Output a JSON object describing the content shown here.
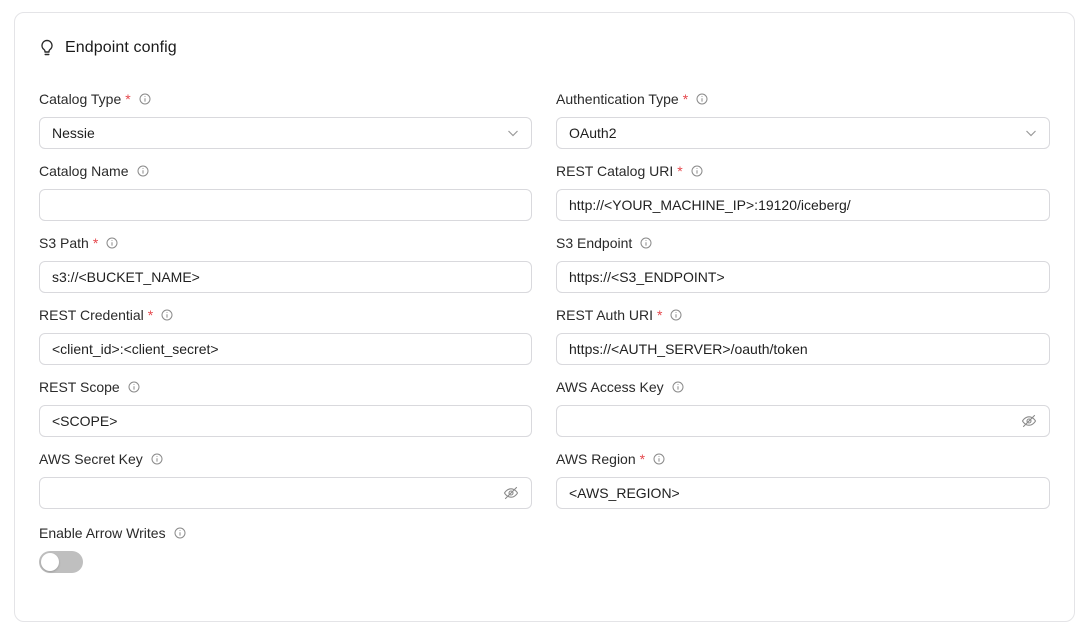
{
  "header": {
    "title": "Endpoint config",
    "icon": "lightbulb-icon"
  },
  "fields": {
    "catalog_type": {
      "label": "Catalog Type",
      "required": "*",
      "value": "Nessie"
    },
    "auth_type": {
      "label": "Authentication Type",
      "required": "*",
      "value": "OAuth2"
    },
    "catalog_name": {
      "label": "Catalog Name",
      "value": ""
    },
    "rest_catalog_uri": {
      "label": "REST Catalog URI",
      "required": "*",
      "value": "http://<YOUR_MACHINE_IP>:19120/iceberg/"
    },
    "s3_path": {
      "label": "S3 Path",
      "required": "*",
      "value": "s3://<BUCKET_NAME>"
    },
    "s3_endpoint": {
      "label": "S3 Endpoint",
      "value": "https://<S3_ENDPOINT>"
    },
    "rest_credential": {
      "label": "REST Credential",
      "required": "*",
      "value": "<client_id>:<client_secret>"
    },
    "rest_auth_uri": {
      "label": "REST Auth URI",
      "required": "*",
      "value": "https://<AUTH_SERVER>/oauth/token"
    },
    "rest_scope": {
      "label": "REST Scope",
      "value": "<SCOPE>"
    },
    "aws_access_key": {
      "label": "AWS Access Key",
      "value": ""
    },
    "aws_secret_key": {
      "label": "AWS Secret Key",
      "value": ""
    },
    "aws_region": {
      "label": "AWS Region",
      "required": "*",
      "value": "<AWS_REGION>"
    },
    "enable_arrow_writes": {
      "label": "Enable Arrow Writes",
      "enabled": false
    }
  },
  "colors": {
    "required": "#e5484d",
    "border": "#d9d9dd",
    "toggle_off": "#bfbfbf"
  }
}
